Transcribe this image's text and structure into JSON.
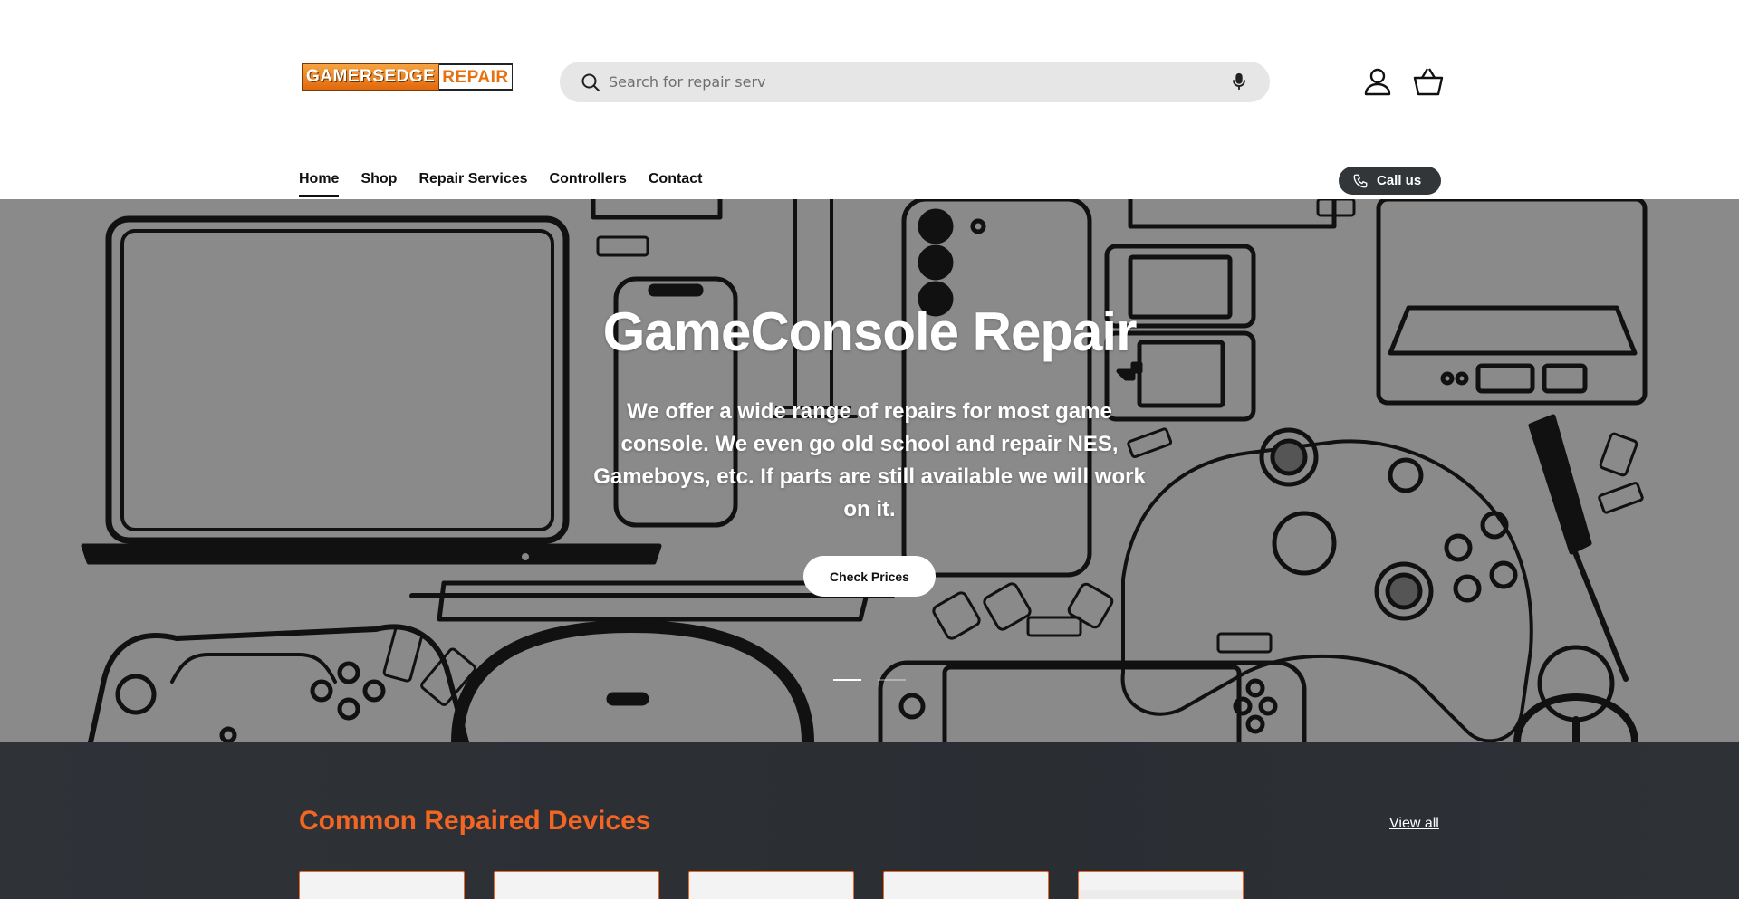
{
  "header": {
    "logo": {
      "part1": "GAMERSEDGE",
      "part2": "REPAIR"
    },
    "search": {
      "value": "",
      "placeholder": "Search for repair serv"
    },
    "icons": {
      "search": "search-icon",
      "mic": "microphone-icon",
      "account": "account-icon",
      "cart": "basket-icon"
    }
  },
  "nav": {
    "items": [
      {
        "label": "Home",
        "active": true
      },
      {
        "label": "Shop"
      },
      {
        "label": "Repair Services"
      },
      {
        "label": "Controllers"
      },
      {
        "label": "Contact"
      }
    ],
    "call_label": "Call us"
  },
  "hero": {
    "title": "GameConsole Repair",
    "text": "We offer a wide range of repairs for most game console. We even go old school and repair NES, Gameboys, etc. If parts are still available we will work on it.",
    "button": "Check Prices",
    "slides": 2,
    "active_slide": 1
  },
  "collection": {
    "title": "Common Repaired Devices",
    "view_all": "View all",
    "card_count": 5
  },
  "colors": {
    "accent": "#f26522",
    "hero_bg": "#8a8a8a",
    "section_bg": "#2d3136",
    "call_button_bg": "#333639"
  }
}
